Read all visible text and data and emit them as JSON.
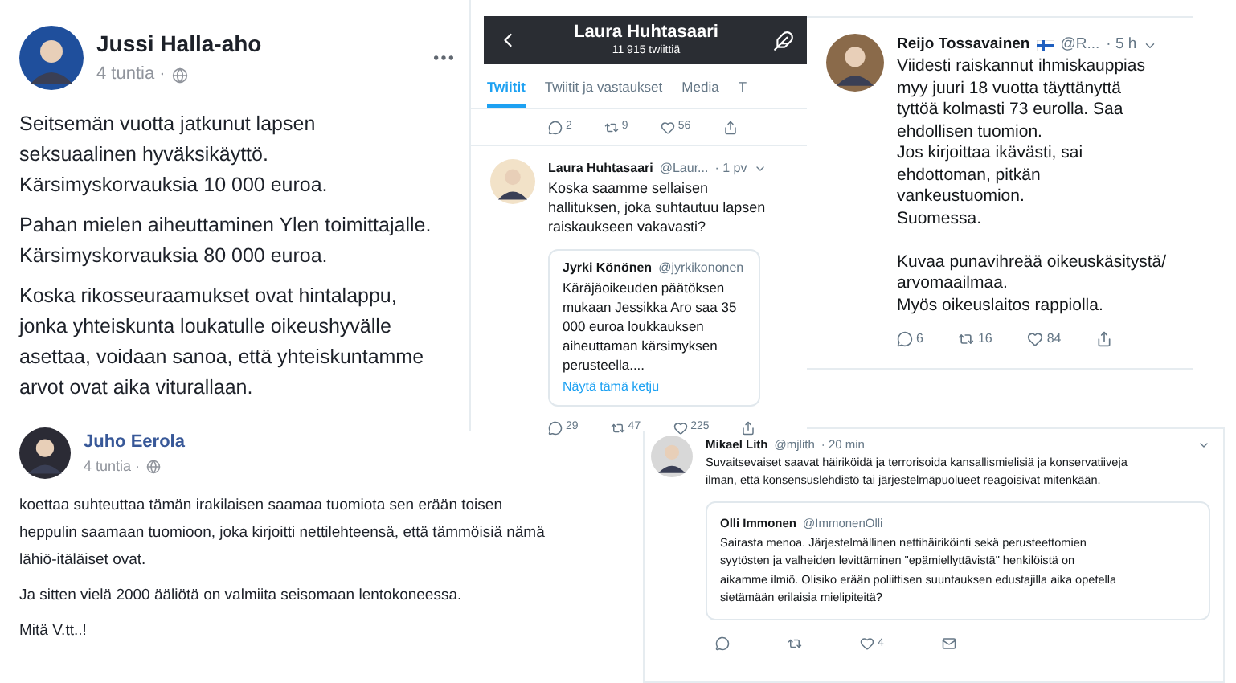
{
  "posts": [
    {
      "kind": "facebook",
      "author": "Jussi Halla-aho",
      "time": "4 tuntia ·",
      "paragraphs": [
        "Seitsemän vuotta jatkunut lapsen\nseksuaalinen hyväksikäyttö.\nKärsimyskorvauksia 10 000 euroa.",
        "Pahan mielen aiheuttaminen Ylen toimittajalle.\nKärsimyskorvauksia 80 000 euroa.",
        "Koska rikosseuraamukset ovat hintalappu,\njonka yhteiskunta loukatulle oikeushyvälle\nasettaa, voidaan sanoa, että yhteiskuntamme\narvot ovat aika viturallaan."
      ]
    },
    {
      "kind": "profile",
      "header_title": "Laura Huhtasaari",
      "header_subtitle": "11 915 twiittiä",
      "tabs": [
        {
          "label": "Twiitit",
          "selected": true
        },
        {
          "label": "Twiitit ja vastaukset",
          "selected": false
        },
        {
          "label": "Media",
          "selected": false
        },
        {
          "label": "T",
          "selected": false
        }
      ],
      "top_counts": {
        "replies": "2",
        "retweets": "9",
        "likes": "56"
      },
      "author": "Laura Huhtasaari",
      "handle": "@Laur...",
      "time": "· 1 pv",
      "text": "Koska saamme sellaisen\nhallituksen, joka suhtautuu lapsen\nraiskaukseen vakavasti?",
      "quote": {
        "author": "Jyrki Könönen",
        "handle": "@jyrkikononen",
        "text": "Käräjäoikeuden päätöksen\nmukaan Jessikka Aro saa 35\n000 euroa loukkauksen\naiheuttaman kärsimyksen\nperusteella....",
        "link": "Näytä tämä ketju"
      },
      "counts": {
        "replies": "29",
        "retweets": "47",
        "likes": "225"
      }
    },
    {
      "kind": "tweet",
      "author": "Reijo Tossavainen",
      "handle": "@R...",
      "time": "· 5 h",
      "text": "Viidesti raiskannut ihmiskauppias\nmyy juuri 18 vuotta täyttänyttä\ntyttöä kolmasti 73 eurolla. Saa\nehdollisen tuomion.\nJos kirjoittaa ikävästi, sai\nehdottoman, pitkän\nvankeustuomion.\nSuomessa.\n\nKuvaa punavihreää oikeuskäsitystä/\narvomaailmaa.\nMyös oikeuslaitos rappiolla.",
      "counts": {
        "replies": "6",
        "retweets": "16",
        "likes": "84"
      }
    },
    {
      "kind": "facebook",
      "author": "Juho Eerola",
      "time": "4 tuntia ·",
      "paragraphs": [
        "koettaa suhteuttaa tämän irakilaisen saamaa tuomiota sen erään toisen\nheppulin saamaan tuomioon, joka kirjoitti nettilehteensä, että tämmöisiä nämä\nlähiö-itäläiset ovat.",
        "Ja sitten vielä 2000 ääliötä on valmiita seisomaan lentokoneessa.",
        "Mitä V.tt..!"
      ]
    },
    {
      "kind": "tweet_wide",
      "author": "Mikael Lith",
      "handle": "@mjlith",
      "time": "· 20 min",
      "text": "Suvaitsevaiset saavat häiriköidä ja terrorisoida kansallismielisiä ja konservatiiveja\nilman, että konsensuslehdistö tai järjestelmäpuolueet reagoisivat mitenkään.",
      "quote": {
        "author": "Olli Immonen",
        "handle": "@ImmonenOlli",
        "text": "Sairasta menoa. Järjestelmällinen nettihäiriköinti sekä perusteettomien\nsyytösten ja valheiden levittäminen \"epämiellyttävistä\" henkilöistä on\naikamme ilmiö. Olisiko erään poliittisen suuntauksen edustajilla aika opetella\nsietämään erilaisia mielipiteitä?"
      },
      "counts": {
        "likes": "4"
      }
    }
  ]
}
